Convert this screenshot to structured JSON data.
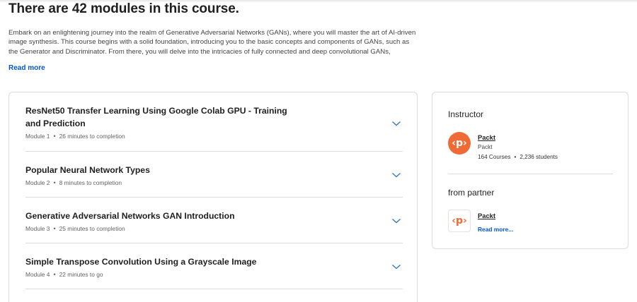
{
  "heading": "There are 42 modules in this course.",
  "description": "Embark on an enlightening journey into the realm of Generative Adversarial Networks (GANs), where you will master the art of AI-driven image synthesis. This course begins with a solid foundation, introducing you to the basic concepts and components of GANs, such as the Generator and Discriminator. From there, you will delve into the intricacies of fully connected and deep convolutional GANs,",
  "read_more_label": "Read more",
  "modules": [
    {
      "title": "ResNet50 Transfer Learning Using Google Colab GPU - Training and Prediction",
      "number": "Module 1",
      "duration": "26 minutes to completion"
    },
    {
      "title": "Popular Neural Network Types",
      "number": "Module 2",
      "duration": "8 minutes to completion"
    },
    {
      "title": "Generative Adversarial Networks GAN Introduction",
      "number": "Module 3",
      "duration": "25 minutes to completion"
    },
    {
      "title": "Simple Transpose Convolution Using a Grayscale Image",
      "number": "Module 4",
      "duration": "22 minutes to go"
    }
  ],
  "meta_separator": "•",
  "instructor": {
    "heading": "Instructor",
    "name": "Packt",
    "org": "Packt",
    "courses": "164 Courses",
    "students": "2,236 students",
    "logo_glyph": "‹p›",
    "logo_icon": "packt-logo-icon"
  },
  "partner": {
    "heading": "from partner",
    "name": "Packt",
    "read_more": "Read more...",
    "logo_glyph": "‹p›",
    "logo_icon": "packt-logo-icon"
  },
  "colors": {
    "brand_orange": "#f06a35",
    "link_blue": "#0056d2",
    "chevron_blue": "#2a73cc"
  }
}
